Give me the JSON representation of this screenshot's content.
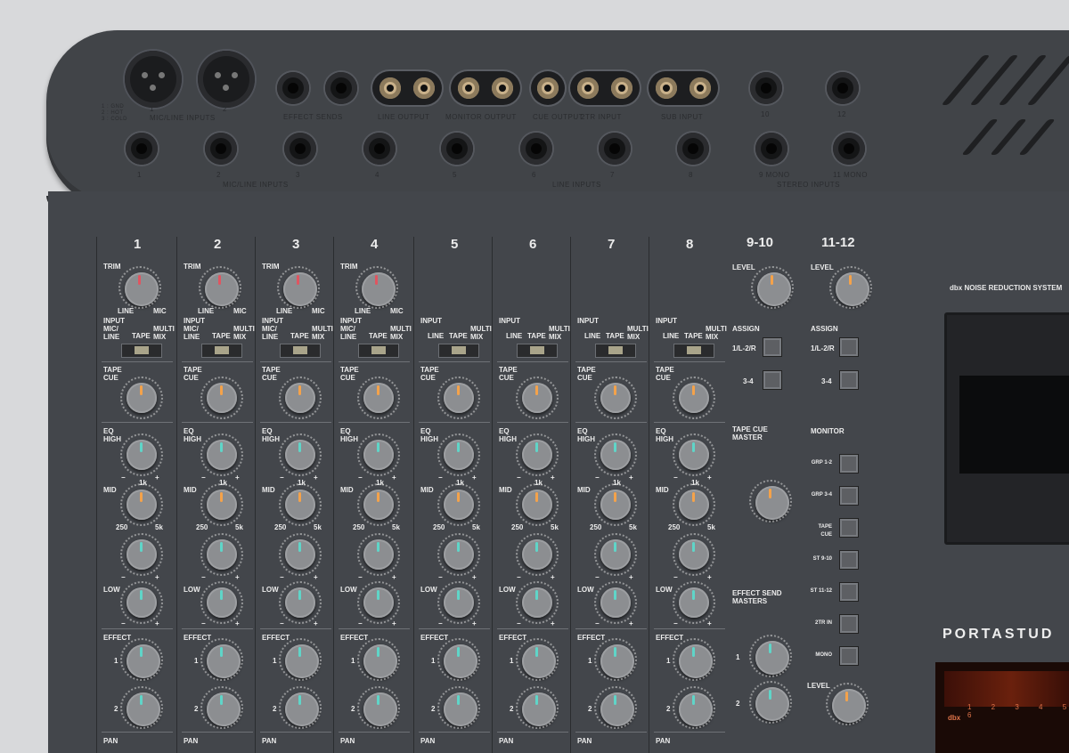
{
  "jack_panel": {
    "xlr_caption": "MIC/LINE INPUTS",
    "xlr_numbers": [
      "1",
      "2"
    ],
    "pin_legend": [
      "1 : GND",
      "2 : HOT",
      "3 : COLD"
    ],
    "effect_sends": "EFFECT SENDS",
    "effect_send_numbers": [
      "1",
      "2"
    ],
    "line_output": "LINE OUTPUT",
    "monitor_output": "MONITOR OUTPUT",
    "cue_output": "CUE OUTPUT",
    "tr2_input": "2TR INPUT",
    "sub_input": "SUB INPUT",
    "lr": [
      "L",
      "R"
    ],
    "top_right_numbers": [
      "10",
      "12"
    ],
    "bottom_numbers": [
      "1",
      "2",
      "3",
      "4",
      "5",
      "6",
      "7",
      "8",
      "9 MONO",
      "11 MONO"
    ],
    "mic_line_inputs": "MIC/LINE INPUTS",
    "line_inputs": "LINE INPUTS",
    "stereo_inputs": "STEREO INPUTS"
  },
  "channels": [
    {
      "num": "1",
      "has_trim": true
    },
    {
      "num": "2",
      "has_trim": true
    },
    {
      "num": "3",
      "has_trim": true
    },
    {
      "num": "4",
      "has_trim": true
    },
    {
      "num": "5",
      "has_trim": false
    },
    {
      "num": "6",
      "has_trim": false
    },
    {
      "num": "7",
      "has_trim": false
    },
    {
      "num": "8",
      "has_trim": false
    }
  ],
  "labels": {
    "trim": "TRIM",
    "line": "LINE",
    "mic": "MIC",
    "input": "INPUT",
    "mic_line": "MIC/\nLINE",
    "tape": "TAPE",
    "multi_mix": "MULTI\nMIX",
    "tape_cue": "TAPE\nCUE",
    "eq_high": "EQ\nHIGH",
    "mid": "MID",
    "low": "LOW",
    "f1k": "1k",
    "f250": "250",
    "f5k": "5k",
    "minus": "−",
    "plus": "+",
    "effect": "EFFECT",
    "one": "1",
    "two": "2",
    "pan": "PAN"
  },
  "stereo_strips": [
    {
      "num": "9-10",
      "level": "LEVEL",
      "assign": "ASSIGN",
      "assign_buttons": [
        "1/L-2/R",
        "3-4"
      ]
    },
    {
      "num": "11-12",
      "level": "LEVEL",
      "assign": "ASSIGN",
      "assign_buttons": [
        "1/L-2/R",
        "3-4"
      ]
    }
  ],
  "tape_cue_master": "TAPE CUE\nMASTER",
  "effect_send_masters": "EFFECT SEND\nMASTERS",
  "monitor": {
    "title": "MONITOR",
    "buttons": [
      "GRP 1-2",
      "GRP 3-4",
      "TAPE\nCUE",
      "ST 9-10",
      "ST 11-12",
      "2TR IN",
      "MONO"
    ],
    "level": "LEVEL"
  },
  "noise_reduction": "dbx NOISE REDUCTION SYSTEM",
  "brand": "PORTASTUD",
  "meter_scale": "1 2 3 4 5 6",
  "meter_dbx": "dbx"
}
